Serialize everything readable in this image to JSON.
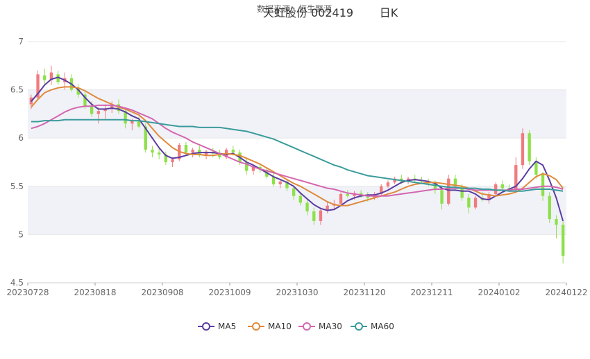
{
  "chart_data": {
    "type": "candlestick",
    "source_note": "数据来源：恒生聚源",
    "title": "天虹股份 002419",
    "period": "日K",
    "ylim": [
      4.5,
      7
    ],
    "yticks": [
      "4.5",
      "5",
      "5.5",
      "6",
      "6.5",
      "7"
    ],
    "xticks": [
      "20230728",
      "20230818",
      "20230908",
      "20231009",
      "20231030",
      "20231120",
      "20231211",
      "20240102",
      "20240122"
    ],
    "colors": {
      "up": "#f07b7f",
      "down": "#8ee04a",
      "band": "#f0f2f8",
      "grid": "#e6e6e6"
    },
    "legend": [
      {
        "name": "MA5",
        "color": "#5b3da0"
      },
      {
        "name": "MA10",
        "color": "#e08a3c"
      },
      {
        "name": "MA30",
        "color": "#d466b0"
      },
      {
        "name": "MA60",
        "color": "#3b9b9b"
      }
    ],
    "ohlc": [
      [
        6.35,
        6.45,
        6.3,
        6.42
      ],
      [
        6.42,
        6.7,
        6.4,
        6.66
      ],
      [
        6.65,
        6.72,
        6.55,
        6.6
      ],
      [
        6.6,
        6.75,
        6.55,
        6.68
      ],
      [
        6.66,
        6.7,
        6.55,
        6.58
      ],
      [
        6.58,
        6.68,
        6.5,
        6.62
      ],
      [
        6.62,
        6.66,
        6.48,
        6.5
      ],
      [
        6.52,
        6.56,
        6.42,
        6.45
      ],
      [
        6.45,
        6.48,
        6.3,
        6.33
      ],
      [
        6.33,
        6.38,
        6.22,
        6.25
      ],
      [
        6.25,
        6.32,
        6.15,
        6.28
      ],
      [
        6.28,
        6.35,
        6.2,
        6.3
      ],
      [
        6.3,
        6.38,
        6.26,
        6.35
      ],
      [
        6.35,
        6.4,
        6.25,
        6.28
      ],
      [
        6.28,
        6.3,
        6.1,
        6.15
      ],
      [
        6.15,
        6.2,
        6.08,
        6.18
      ],
      [
        6.18,
        6.22,
        6.1,
        6.12
      ],
      [
        6.12,
        6.15,
        5.85,
        5.88
      ],
      [
        5.88,
        5.92,
        5.8,
        5.85
      ],
      [
        5.85,
        5.9,
        5.78,
        5.83
      ],
      [
        5.83,
        5.86,
        5.72,
        5.75
      ],
      [
        5.75,
        5.8,
        5.7,
        5.78
      ],
      [
        5.78,
        5.95,
        5.76,
        5.93
      ],
      [
        5.93,
        5.96,
        5.82,
        5.85
      ],
      [
        5.85,
        5.9,
        5.8,
        5.88
      ],
      [
        5.88,
        5.92,
        5.8,
        5.82
      ],
      [
        5.82,
        5.88,
        5.78,
        5.86
      ],
      [
        5.86,
        5.9,
        5.8,
        5.84
      ],
      [
        5.84,
        5.88,
        5.78,
        5.8
      ],
      [
        5.8,
        5.9,
        5.78,
        5.88
      ],
      [
        5.88,
        5.92,
        5.82,
        5.85
      ],
      [
        5.85,
        5.88,
        5.72,
        5.75
      ],
      [
        5.75,
        5.8,
        5.62,
        5.66
      ],
      [
        5.66,
        5.72,
        5.62,
        5.7
      ],
      [
        5.7,
        5.74,
        5.64,
        5.67
      ],
      [
        5.67,
        5.7,
        5.58,
        5.6
      ],
      [
        5.6,
        5.64,
        5.5,
        5.52
      ],
      [
        5.52,
        5.58,
        5.48,
        5.55
      ],
      [
        5.55,
        5.58,
        5.45,
        5.48
      ],
      [
        5.48,
        5.5,
        5.36,
        5.4
      ],
      [
        5.4,
        5.44,
        5.3,
        5.33
      ],
      [
        5.33,
        5.36,
        5.2,
        5.24
      ],
      [
        5.24,
        5.28,
        5.1,
        5.14
      ],
      [
        5.14,
        5.28,
        5.1,
        5.25
      ],
      [
        5.25,
        5.34,
        5.22,
        5.3
      ],
      [
        5.3,
        5.36,
        5.26,
        5.32
      ],
      [
        5.32,
        5.44,
        5.3,
        5.42
      ],
      [
        5.42,
        5.46,
        5.38,
        5.4
      ],
      [
        5.4,
        5.45,
        5.36,
        5.43
      ],
      [
        5.43,
        5.46,
        5.38,
        5.4
      ],
      [
        5.4,
        5.44,
        5.34,
        5.38
      ],
      [
        5.38,
        5.44,
        5.36,
        5.42
      ],
      [
        5.42,
        5.52,
        5.4,
        5.5
      ],
      [
        5.5,
        5.56,
        5.48,
        5.54
      ],
      [
        5.54,
        5.6,
        5.52,
        5.58
      ],
      [
        5.58,
        5.62,
        5.52,
        5.55
      ],
      [
        5.55,
        5.6,
        5.52,
        5.58
      ],
      [
        5.58,
        5.62,
        5.54,
        5.56
      ],
      [
        5.56,
        5.6,
        5.52,
        5.55
      ],
      [
        5.55,
        5.58,
        5.5,
        5.53
      ],
      [
        5.53,
        5.56,
        5.42,
        5.46
      ],
      [
        5.46,
        5.5,
        5.26,
        5.32
      ],
      [
        5.32,
        5.62,
        5.3,
        5.58
      ],
      [
        5.58,
        5.62,
        5.46,
        5.5
      ],
      [
        5.5,
        5.52,
        5.35,
        5.38
      ],
      [
        5.38,
        5.42,
        5.22,
        5.28
      ],
      [
        5.28,
        5.4,
        5.26,
        5.38
      ],
      [
        5.38,
        5.44,
        5.34,
        5.36
      ],
      [
        5.36,
        5.44,
        5.32,
        5.42
      ],
      [
        5.42,
        5.54,
        5.4,
        5.52
      ],
      [
        5.52,
        5.56,
        5.46,
        5.48
      ],
      [
        5.48,
        5.52,
        5.44,
        5.46
      ],
      [
        5.46,
        5.8,
        5.44,
        5.72
      ],
      [
        5.72,
        6.1,
        5.68,
        6.05
      ],
      [
        6.05,
        6.08,
        5.72,
        5.76
      ],
      [
        5.76,
        5.8,
        5.58,
        5.62
      ],
      [
        5.62,
        5.65,
        5.35,
        5.4
      ],
      [
        5.4,
        5.44,
        5.12,
        5.16
      ],
      [
        5.16,
        5.2,
        4.96,
        5.1
      ],
      [
        5.1,
        5.14,
        4.7,
        4.78
      ]
    ],
    "ma": {
      "MA5": [
        6.38,
        6.46,
        6.55,
        6.61,
        6.63,
        6.6,
        6.56,
        6.5,
        6.42,
        6.35,
        6.3,
        6.3,
        6.31,
        6.3,
        6.27,
        6.23,
        6.2,
        6.1,
        6.0,
        5.9,
        5.82,
        5.79,
        5.8,
        5.82,
        5.84,
        5.85,
        5.85,
        5.85,
        5.84,
        5.83,
        5.84,
        5.8,
        5.75,
        5.72,
        5.68,
        5.64,
        5.6,
        5.57,
        5.54,
        5.5,
        5.43,
        5.37,
        5.31,
        5.27,
        5.25,
        5.26,
        5.3,
        5.35,
        5.38,
        5.4,
        5.41,
        5.41,
        5.43,
        5.46,
        5.5,
        5.54,
        5.56,
        5.57,
        5.56,
        5.55,
        5.53,
        5.48,
        5.46,
        5.46,
        5.45,
        5.45,
        5.42,
        5.37,
        5.36,
        5.4,
        5.44,
        5.47,
        5.5,
        5.58,
        5.68,
        5.76,
        5.72,
        5.56,
        5.38,
        5.14
      ],
      "MA10": [
        6.32,
        6.4,
        6.47,
        6.5,
        6.52,
        6.53,
        6.53,
        6.52,
        6.49,
        6.45,
        6.41,
        6.38,
        6.35,
        6.32,
        6.3,
        6.27,
        6.24,
        6.18,
        6.1,
        6.02,
        5.96,
        5.9,
        5.86,
        5.84,
        5.83,
        5.83,
        5.82,
        5.82,
        5.83,
        5.84,
        5.83,
        5.82,
        5.79,
        5.76,
        5.73,
        5.69,
        5.65,
        5.61,
        5.57,
        5.53,
        5.5,
        5.46,
        5.42,
        5.38,
        5.34,
        5.31,
        5.3,
        5.3,
        5.32,
        5.34,
        5.36,
        5.38,
        5.4,
        5.42,
        5.44,
        5.47,
        5.5,
        5.52,
        5.53,
        5.54,
        5.54,
        5.53,
        5.52,
        5.51,
        5.5,
        5.48,
        5.45,
        5.42,
        5.41,
        5.4,
        5.41,
        5.42,
        5.44,
        5.48,
        5.54,
        5.6,
        5.63,
        5.61,
        5.57,
        5.48
      ],
      "MA30": [
        6.1,
        6.12,
        6.15,
        6.19,
        6.23,
        6.27,
        6.3,
        6.32,
        6.33,
        6.33,
        6.34,
        6.34,
        6.34,
        6.33,
        6.31,
        6.29,
        6.26,
        6.23,
        6.2,
        6.15,
        6.1,
        6.06,
        6.03,
        6.0,
        5.96,
        5.93,
        5.9,
        5.87,
        5.84,
        5.81,
        5.78,
        5.75,
        5.73,
        5.7,
        5.68,
        5.66,
        5.64,
        5.62,
        5.6,
        5.58,
        5.56,
        5.54,
        5.52,
        5.5,
        5.48,
        5.47,
        5.45,
        5.43,
        5.42,
        5.41,
        5.4,
        5.4,
        5.4,
        5.4,
        5.41,
        5.42,
        5.43,
        5.44,
        5.45,
        5.46,
        5.47,
        5.47,
        5.48,
        5.48,
        5.48,
        5.47,
        5.46,
        5.46,
        5.46,
        5.46,
        5.46,
        5.46,
        5.47,
        5.47,
        5.48,
        5.49,
        5.5,
        5.5,
        5.49,
        5.47
      ],
      "MA60": [
        6.17,
        6.17,
        6.18,
        6.18,
        6.18,
        6.19,
        6.19,
        6.19,
        6.19,
        6.19,
        6.19,
        6.19,
        6.19,
        6.19,
        6.19,
        6.18,
        6.18,
        6.17,
        6.16,
        6.15,
        6.14,
        6.13,
        6.12,
        6.12,
        6.12,
        6.11,
        6.11,
        6.11,
        6.11,
        6.1,
        6.09,
        6.08,
        6.07,
        6.05,
        6.03,
        6.01,
        5.99,
        5.96,
        5.93,
        5.9,
        5.87,
        5.84,
        5.81,
        5.78,
        5.75,
        5.72,
        5.7,
        5.67,
        5.65,
        5.63,
        5.61,
        5.6,
        5.59,
        5.58,
        5.57,
        5.56,
        5.55,
        5.54,
        5.53,
        5.52,
        5.51,
        5.5,
        5.49,
        5.49,
        5.48,
        5.48,
        5.48,
        5.47,
        5.47,
        5.46,
        5.46,
        5.45,
        5.45,
        5.45,
        5.46,
        5.47,
        5.47,
        5.47,
        5.46,
        5.45
      ]
    }
  }
}
